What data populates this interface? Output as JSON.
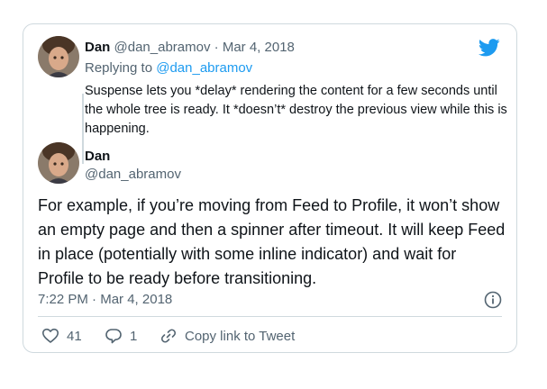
{
  "colors": {
    "border": "#cfd9de",
    "text": "#0f1419",
    "muted": "#536471",
    "link": "#1d9bf0",
    "twitter_blue": "#1d9bf0"
  },
  "reply_tweet": {
    "author_name": "Dan",
    "handle": "@dan_abramov",
    "separator": "·",
    "date": "Mar 4, 2018",
    "replying_prefix": "Replying to",
    "replying_to": "@dan_abramov",
    "text": "Suspense lets you *delay* rendering the content for a few seconds until the whole tree is ready. It *doesn’t* destroy the previous view while this is happening."
  },
  "main_tweet": {
    "author_name": "Dan",
    "handle": "@dan_abramov",
    "text": "For example, if you’re moving from Feed to Profile, it won’t show an empty page and then a spinner after timeout. It will keep Feed in place (potentially with some inline indicator) and wait for Profile to be ready before transitioning.",
    "time": "7:22 PM",
    "separator": "·",
    "date": "Mar 4, 2018"
  },
  "actions": {
    "like_count": "41",
    "reply_count": "1",
    "copy_link_label": "Copy link to Tweet"
  },
  "icons": [
    "twitter-logo-icon",
    "info-icon",
    "heart-icon",
    "reply-bubble-icon",
    "link-icon"
  ]
}
